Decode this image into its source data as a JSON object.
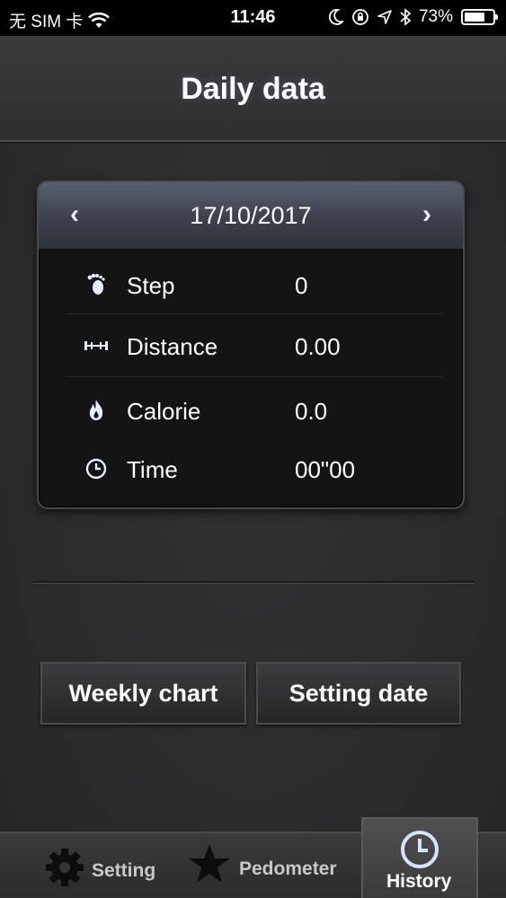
{
  "status_bar": {
    "carrier": "无 SIM 卡",
    "time": "11:46",
    "battery_percent": "73%",
    "battery_level": 0.73,
    "icons": [
      "wifi-icon",
      "moon-icon",
      "orientation-lock-icon",
      "location-arrow-icon",
      "bluetooth-icon",
      "battery-icon"
    ]
  },
  "header": {
    "title": "Daily data"
  },
  "daily_card": {
    "date": "17/10/2017",
    "prev_label": "‹",
    "next_label": "›",
    "rows": [
      {
        "icon": "footprint-icon",
        "label": "Step",
        "value": "0"
      },
      {
        "icon": "distance-icon",
        "label": "Distance",
        "value": "0.00"
      },
      {
        "icon": "flame-icon",
        "label": "Calorie",
        "value": "0.0"
      },
      {
        "icon": "clock-icon",
        "label": "Time",
        "value": "00\"00"
      }
    ]
  },
  "buttons": {
    "weekly_chart": "Weekly chart",
    "setting_date": "Setting date"
  },
  "tab_bar": {
    "tabs": [
      {
        "icon": "gear-icon",
        "label": "Setting",
        "active": false
      },
      {
        "icon": "star-icon",
        "label": "Pedometer",
        "active": false
      },
      {
        "icon": "clock-icon",
        "label": "History",
        "active": true
      }
    ]
  },
  "colors": {
    "background": "#2b2b2c",
    "card_background": "#141415",
    "date_bar": "#4a4f5c",
    "icon_blue": "#cfe0ff"
  }
}
